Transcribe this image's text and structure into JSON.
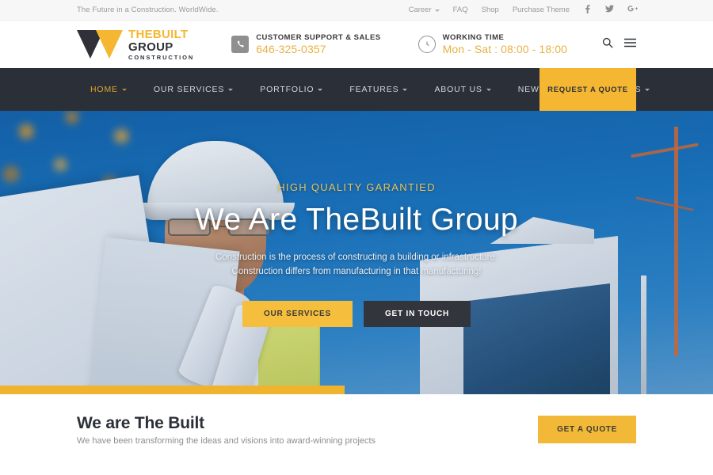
{
  "topbar": {
    "tagline": "The Future in a Construction. WorldWide.",
    "links": [
      {
        "label": "Career",
        "has_caret": true
      },
      {
        "label": "FAQ",
        "has_caret": false
      },
      {
        "label": "Shop",
        "has_caret": false
      },
      {
        "label": "Purchase Theme",
        "has_caret": false
      }
    ],
    "social": [
      {
        "name": "facebook-icon",
        "glyph": "f"
      },
      {
        "name": "twitter-icon",
        "glyph": "🐦"
      },
      {
        "name": "google-plus-icon",
        "glyph": "G+"
      }
    ]
  },
  "header": {
    "logo": {
      "line1": "THEBUILT",
      "line2": "GROUP",
      "line3": "CONSTRUCTION"
    },
    "support": {
      "label": "CUSTOMER SUPPORT & SALES",
      "value": "646-325-0357",
      "icon": "phone-icon"
    },
    "working": {
      "label": "WORKING TIME",
      "value": "Mon - Sat : 08:00 - 18:00",
      "icon": "clock-icon"
    },
    "tools": [
      {
        "name": "search-icon"
      },
      {
        "name": "hamburger-menu-icon"
      }
    ]
  },
  "nav": {
    "items": [
      {
        "label": "HOME",
        "caret": true,
        "active": true
      },
      {
        "label": "OUR SERVICES",
        "caret": true,
        "active": false
      },
      {
        "label": "PORTFOLIO",
        "caret": true,
        "active": false
      },
      {
        "label": "FEATURES",
        "caret": true,
        "active": false
      },
      {
        "label": "ABOUT US",
        "caret": true,
        "active": false
      },
      {
        "label": "NEWS",
        "caret": true,
        "active": false
      },
      {
        "label": "CONTACT US",
        "caret": true,
        "active": false
      }
    ],
    "quote_button": "REQUEST A QUOTE"
  },
  "hero": {
    "kicker": "HIGH QUALITY GARANTIED",
    "title": "We Are TheBuilt Group",
    "subtitle_line1": "Construction is the process of constructing a building or infrastructure.",
    "subtitle_line2": "Construction differs from manufacturing in that manufacturing!",
    "primary_button": "OUR SERVICES",
    "secondary_button": "GET IN TOUCH"
  },
  "about": {
    "title": "We are The Built",
    "subtitle": "We have been transforming the ideas and visions into award-winning projects",
    "button": "GET A QUOTE"
  },
  "colors": {
    "accent": "#f5b731",
    "accent_bar": "#f0b32e",
    "nav_bg": "#2b3038",
    "dark_text": "#2b3038",
    "muted_text": "#8d8d8d",
    "phone_gold": "#e6b243",
    "hero_sky": "#1a74bd"
  }
}
